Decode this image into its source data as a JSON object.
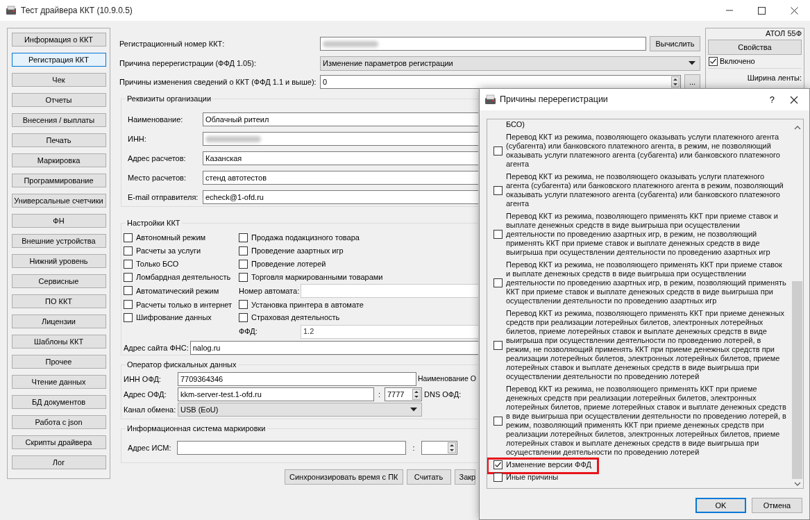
{
  "window": {
    "title": "Тест драйвера ККТ (10.9.0.5)"
  },
  "sidebar": {
    "items": [
      {
        "label": "Информация о ККТ",
        "selected": false
      },
      {
        "label": "Регистрация ККТ",
        "selected": true
      },
      {
        "label": "Чек",
        "selected": false
      },
      {
        "label": "Отчеты",
        "selected": false
      },
      {
        "label": "Внесения / выплаты",
        "selected": false
      },
      {
        "label": "Печать",
        "selected": false
      },
      {
        "label": "Маркировка",
        "selected": false
      },
      {
        "label": "Программирование",
        "selected": false
      },
      {
        "label": "Универсальные счетчики",
        "selected": false
      },
      {
        "label": "ФН",
        "selected": false
      },
      {
        "label": "Внешние устройства",
        "selected": false
      },
      {
        "label": "Нижний уровень",
        "selected": false
      },
      {
        "label": "Сервисные",
        "selected": false
      },
      {
        "label": "ПО ККТ",
        "selected": false
      },
      {
        "label": "Лицензии",
        "selected": false
      },
      {
        "label": "Шаблоны ККТ",
        "selected": false
      },
      {
        "label": "Прочее",
        "selected": false
      },
      {
        "label": "Чтение данных",
        "selected": false
      },
      {
        "label": "БД документов",
        "selected": false
      },
      {
        "label": "Работа с json",
        "selected": false
      },
      {
        "label": "Скрипты драйвера",
        "selected": false
      },
      {
        "label": "Лог",
        "selected": false
      }
    ]
  },
  "registration": {
    "reg_number": {
      "label": "Регистрационный номер ККТ:",
      "obscured": true,
      "button": "Вычислить"
    },
    "reason": {
      "label": "Причина перерегистрации (ФФД 1.05):",
      "value": "Изменение параметров регистрации"
    },
    "change_reasons": {
      "label": "Причины изменения сведений о ККТ (ФФД 1.1 и выше):",
      "value": "0",
      "button": "..."
    }
  },
  "organization": {
    "title": "Реквизиты организации",
    "fields": [
      {
        "label": "Наименование:",
        "value": "Облачный ритеил",
        "obscured": false
      },
      {
        "label": "ИНН:",
        "obscured": true
      },
      {
        "label": "Адрес расчетов:",
        "value": "Казанская",
        "obscured": false
      },
      {
        "label": "Место расчетов:",
        "value": "стенд автотестов",
        "obscured": false
      },
      {
        "label": "E-mail отправителя:",
        "value": "echeck@1-ofd.ru",
        "obscured": false
      }
    ]
  },
  "settings": {
    "title": "Настройки ККТ",
    "left": [
      {
        "kind": "checkbox",
        "label": "Автономный режим",
        "checked": false
      },
      {
        "kind": "checkbox",
        "label": "Расчеты за услуги",
        "checked": false
      },
      {
        "kind": "checkbox",
        "label": "Только БСО",
        "checked": false
      },
      {
        "kind": "checkbox",
        "label": "Ломбардная деятельность",
        "checked": false
      },
      {
        "kind": "checkbox",
        "label": "Автоматический режим",
        "checked": false
      },
      {
        "kind": "checkbox",
        "label": "Расчеты только в интернет",
        "checked": false
      },
      {
        "kind": "checkbox",
        "label": "Шифрование данных",
        "checked": false
      }
    ],
    "right": [
      {
        "kind": "checkbox",
        "label": "Продажа подакцизного товара",
        "checked": false
      },
      {
        "kind": "checkbox",
        "label": "Проведение азартных игр",
        "checked": false
      },
      {
        "kind": "checkbox",
        "label": "Проведение лотерей",
        "checked": false
      },
      {
        "kind": "checkbox",
        "label": "Торговля маркированными товарами",
        "checked": false
      },
      {
        "kind": "field",
        "label": "Номер автомата:",
        "disabled": true
      },
      {
        "kind": "checkbox",
        "label": "Установка принтера в автомате",
        "checked": false
      },
      {
        "kind": "checkbox",
        "label": "Страховая деятельность",
        "checked": false
      },
      {
        "kind": "field",
        "label": "ФФД:",
        "value": "1.2",
        "disabled": true
      }
    ],
    "fns_site": {
      "label": "Адрес сайта ФНС:",
      "value": "nalog.ru"
    }
  },
  "ofd": {
    "title": "Оператор фискальных данных",
    "inn": {
      "label": "ИНН ОФД:",
      "value": "7709364346"
    },
    "name_label": "Наименование О",
    "address": {
      "label": "Адрес ОФД:",
      "value": "kkm-server-test.1-ofd.ru",
      "separator": ":",
      "port": "7777"
    },
    "dns_label": "DNS ОФД:",
    "channel": {
      "label": "Канал обмена:",
      "value": "USB (EoU)"
    }
  },
  "ism": {
    "title": "Информационная система маркировки",
    "address": {
      "label": "Адрес ИСМ:",
      "separator": ":"
    }
  },
  "buttons": [
    "Синхронизировать время с ПК",
    "Считать",
    "Закр"
  ],
  "device_panel": {
    "model": "АТОЛ 55Ф",
    "properties_button": "Свойства",
    "enabled": {
      "label": "Включено",
      "checked": true
    },
    "tape_width_label": "Ширина ленты:"
  },
  "dialog": {
    "title": "Причины перерегистрации",
    "help": "?",
    "items": [
      {
        "kind": "fragment",
        "text": "БСО)"
      },
      {
        "kind": "checkbox",
        "text": "Перевод ККТ из режима, позволяющего оказывать услуги платежного агента (субагента) или банковского платежного агента, в режим, не позволяющий оказывать услуги платежного агента (субагента) или банковского платежного агента",
        "checked": false,
        "highlighted": false
      },
      {
        "kind": "checkbox",
        "text": "Перевод ККТ из режима, не позволяющего оказывать услуги платежного агента (субагента) или банковского платежного агента в режим, позволяющий оказывать услуги платежного агента (субагента) или банковского платежного агента",
        "checked": false,
        "highlighted": false
      },
      {
        "kind": "checkbox",
        "text": "Перевод ККТ из режима, позволяющего применять ККТ при приеме ставок и выплате денежных средств в виде выигрыша при осуществлении деятельности по проведению азартных игр, в режим, не позволяющий применять ККТ при приеме ставок и выплате денежных средств в виде выигрыша при осуществлении деятельности по проведению азартных игр",
        "checked": false,
        "highlighted": false
      },
      {
        "kind": "checkbox",
        "text": "Перевод ККТ из режима, не позволяющего применять ККТ при приеме ставок и выплате денежных средств в виде выигрыша при осуществлении деятельности по проведению азартных игр, в режим, позволяющий применять ККТ при приеме ставок и выплате денежных средств в виде выигрыша при осуществлении деятельности по проведению азартных игр",
        "checked": false,
        "highlighted": false
      },
      {
        "kind": "checkbox",
        "text": "Перевод ККТ из режима, позволяющего применять ККТ при приеме денежных средств при реализации лотерейных билетов, электронных лотерейных билетов, приеме лотерейных ставок и выплате денежных средств в виде выигрыша при осуществлении деятельности по проведению лотерей, в режим, не позволяющий применять ККТ при приеме денежных средств при реализации лотерейных билетов, электронных лотерейных билетов, приеме лотерейных ставок и выплате денежных средств в виде выигрыша при осуществлении деятельности по проведению лотерей",
        "checked": false,
        "highlighted": false
      },
      {
        "kind": "checkbox",
        "text": "Перевод ККТ из режима, не позволяющего применять ККТ при приеме денежных средств при реализации лотерейных билетов, электронных лотерейных билетов, приеме лотерейных ставок и выплате денежных средств в виде выигрыша при осуществлении деятельности по проведению лотерей, в режим, позволяющий применять ККТ при приеме денежных средств при реализации лотерейных билетов, электронных лотерейных билетов, приеме лотерейных ставок и выплате денежных средств в виде выигрыша при осуществлении деятельности по проведению лотерей",
        "checked": false,
        "highlighted": false
      },
      {
        "kind": "checkbox",
        "text": "Изменение версии ФФД",
        "checked": true,
        "highlighted": true
      },
      {
        "kind": "checkbox",
        "text": "Иные причины",
        "checked": false,
        "highlighted": false
      }
    ],
    "buttons": [
      {
        "label": "OK",
        "default": true
      },
      {
        "label": "Отмена",
        "default": false
      }
    ]
  }
}
